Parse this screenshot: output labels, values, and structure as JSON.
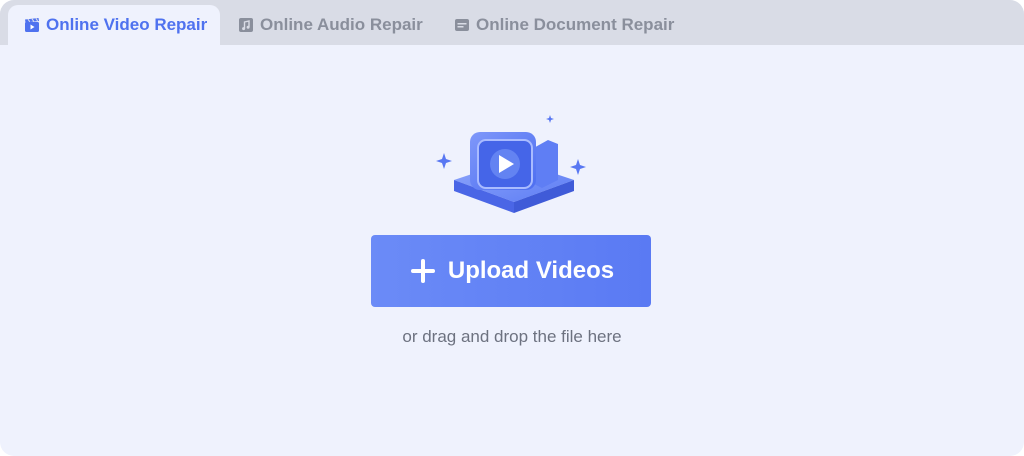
{
  "tabs": [
    {
      "label": "Online Video Repair",
      "icon": "video-clapper-icon",
      "active": true
    },
    {
      "label": "Online Audio Repair",
      "icon": "audio-file-icon",
      "active": false
    },
    {
      "label": "Online Document Repair",
      "icon": "document-icon",
      "active": false
    }
  ],
  "upload": {
    "button_label": "Upload Videos",
    "hint": "or drag and drop the file here",
    "illustration": "video-camera-illustration"
  },
  "colors": {
    "accent": "#4f72ef",
    "tab_bar": "#d9dce6",
    "panel": "#eff2fd",
    "button": "#5a7af3"
  }
}
